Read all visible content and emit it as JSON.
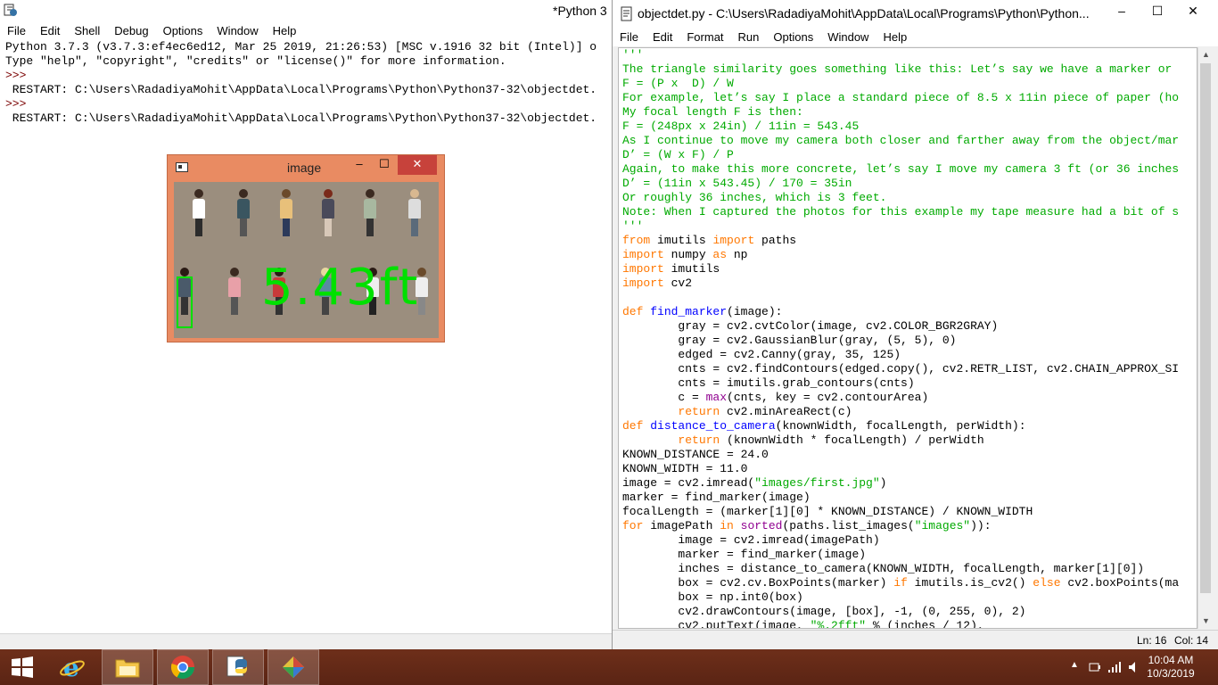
{
  "shell": {
    "title": "*Python 3",
    "menu": [
      "File",
      "Edit",
      "Shell",
      "Debug",
      "Options",
      "Window",
      "Help"
    ],
    "lines": [
      "Python 3.7.3 (v3.7.3:ef4ec6ed12, Mar 25 2019, 21:26:53) [MSC v.1916 32 bit (Intel)] o",
      "Type \"help\", \"copyright\", \"credits\" or \"license()\" for more information.",
      ">>> ",
      " RESTART: C:\\Users\\RadadiyaMohit\\AppData\\Local\\Programs\\Python\\Python37-32\\objectdet.",
      ">>> ",
      " RESTART: C:\\Users\\RadadiyaMohit\\AppData\\Local\\Programs\\Python\\Python37-32\\objectdet."
    ]
  },
  "image_window": {
    "title": "image",
    "minimize": "–",
    "maximize": "☐",
    "close": "✕",
    "overlay_text": "5.43ft"
  },
  "editor": {
    "title": "objectdet.py - C:\\Users\\RadadiyaMohit\\AppData\\Local\\Programs\\Python\\Python...",
    "minimize": "–",
    "maximize": "☐",
    "close": "✕",
    "menu": [
      "File",
      "Edit",
      "Format",
      "Run",
      "Options",
      "Window",
      "Help"
    ],
    "status_line": "Ln: 16",
    "status_col": "Col: 14",
    "code": [
      {
        "t": "'''",
        "c": "c"
      },
      {
        "t": "The triangle similarity goes something like this: Let’s say we have a marker or",
        "c": "c"
      },
      {
        "t": "F = (P x  D) / W",
        "c": "c"
      },
      {
        "t": "For example, let’s say I place a standard piece of 8.5 x 11in piece of paper (ho",
        "c": "c"
      },
      {
        "t": "My focal length F is then:",
        "c": "c"
      },
      {
        "t": "F = (248px x 24in) / 11in = 543.45",
        "c": "c"
      },
      {
        "t": "As I continue to move my camera both closer and farther away from the object/mar",
        "c": "c"
      },
      {
        "t": "D’ = (W x F) / P",
        "c": "c"
      },
      {
        "t": "Again, to make this more concrete, let’s say I move my camera 3 ft (or 36 inches",
        "c": "c"
      },
      {
        "t": "D’ = (11in x 543.45) / 170 = 35in",
        "c": "c"
      },
      {
        "t": "Or roughly 36 inches, which is 3 feet.",
        "c": "c"
      },
      {
        "t": "Note: When I captured the photos for this example my tape measure had a bit of s",
        "c": "c"
      },
      {
        "t": "'''",
        "c": "c"
      },
      {
        "t": "from imutils import paths",
        "c": ""
      },
      {
        "t": "import numpy as np",
        "c": ""
      },
      {
        "t": "import imutils",
        "c": ""
      },
      {
        "t": "import cv2",
        "c": ""
      },
      {
        "t": "",
        "c": ""
      },
      {
        "t": "def find_marker(image):",
        "c": ""
      },
      {
        "t": "        gray = cv2.cvtColor(image, cv2.COLOR_BGR2GRAY)",
        "c": ""
      },
      {
        "t": "        gray = cv2.GaussianBlur(gray, (5, 5), 0)",
        "c": ""
      },
      {
        "t": "        edged = cv2.Canny(gray, 35, 125)",
        "c": ""
      },
      {
        "t": "        cnts = cv2.findContours(edged.copy(), cv2.RETR_LIST, cv2.CHAIN_APPROX_SI",
        "c": ""
      },
      {
        "t": "        cnts = imutils.grab_contours(cnts)",
        "c": ""
      },
      {
        "t": "        c = max(cnts, key = cv2.contourArea)",
        "c": ""
      },
      {
        "t": "        return cv2.minAreaRect(c)",
        "c": ""
      },
      {
        "t": "def distance_to_camera(knownWidth, focalLength, perWidth):",
        "c": ""
      },
      {
        "t": "        return (knownWidth * focalLength) / perWidth",
        "c": ""
      },
      {
        "t": "KNOWN_DISTANCE = 24.0",
        "c": ""
      },
      {
        "t": "KNOWN_WIDTH = 11.0",
        "c": ""
      },
      {
        "t": "image = cv2.imread(\"images/first.jpg\")",
        "c": ""
      },
      {
        "t": "marker = find_marker(image)",
        "c": ""
      },
      {
        "t": "focalLength = (marker[1][0] * KNOWN_DISTANCE) / KNOWN_WIDTH",
        "c": ""
      },
      {
        "t": "for imagePath in sorted(paths.list_images(\"images\")):",
        "c": ""
      },
      {
        "t": "        image = cv2.imread(imagePath)",
        "c": ""
      },
      {
        "t": "        marker = find_marker(image)",
        "c": ""
      },
      {
        "t": "        inches = distance_to_camera(KNOWN_WIDTH, focalLength, marker[1][0])",
        "c": ""
      },
      {
        "t": "        box = cv2.cv.BoxPoints(marker) if imutils.is_cv2() else cv2.boxPoints(ma",
        "c": ""
      },
      {
        "t": "        box = np.int0(box)",
        "c": ""
      },
      {
        "t": "        cv2.drawContours(image, [box], -1, (0, 255, 0), 2)",
        "c": ""
      },
      {
        "t": "        cv2.putText(image, \"%.2fft\" % (inches / 12),",
        "c": ""
      }
    ]
  },
  "taskbar": {
    "time": "10:04 AM",
    "date": "10/3/2019",
    "apps": [
      "start-button",
      "internet-explorer",
      "file-explorer",
      "chrome",
      "python-idle",
      "other-app"
    ]
  },
  "colors": {
    "taskbar": "#6e2f1a",
    "image_window": "#e98b62",
    "code_green": "#00aa00",
    "keyword_orange": "#ff7700"
  }
}
